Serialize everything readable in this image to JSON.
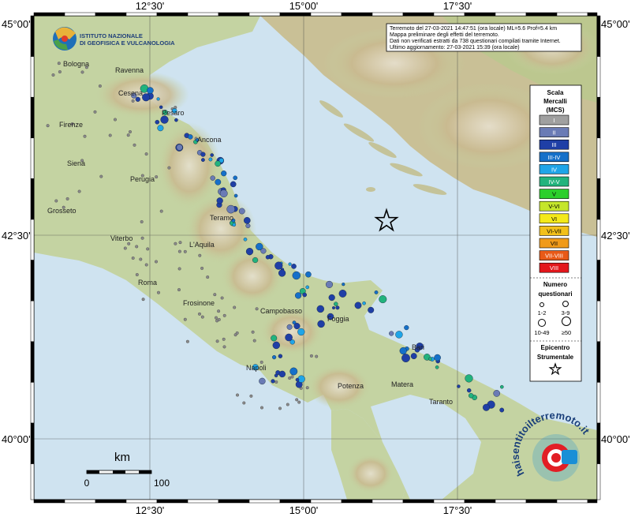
{
  "map": {
    "top_coords": [
      "12°30'",
      "15°00'",
      "17°30'"
    ],
    "bottom_coords": [
      "12°30'",
      "15°00'",
      "17°30'"
    ],
    "left_coords": [
      "45°00'",
      "42°30'",
      "40°00'"
    ],
    "right_coords": [
      "45°00'",
      "42°30'",
      "40°00'"
    ]
  },
  "logo": {
    "line1": "ISTITUTO NAZIONALE",
    "line2": "DI GEOFISICA E VULCANOLOGIA"
  },
  "info": {
    "line1": "Terremoto del 27-03-2021 14:47:51 (ora locale) ML=5.6 Prof=5.4 km",
    "line2": "Mappa preliminare degli effetti del terremoto.",
    "line3": "Dati non verificati estratti da 738 questionari compilati tramite Internet.",
    "line4": "Ultimo aggiornamento: 27-03-2021 15:39 (ora locale)"
  },
  "cities": [
    {
      "name": "Bologna"
    },
    {
      "name": "Ravenna"
    },
    {
      "name": "Cesena"
    },
    {
      "name": "Pesaro"
    },
    {
      "name": "Firenze"
    },
    {
      "name": "Ancona"
    },
    {
      "name": "Siena"
    },
    {
      "name": "Perugia"
    },
    {
      "name": "Grosseto"
    },
    {
      "name": "Teramo"
    },
    {
      "name": "Viterbo"
    },
    {
      "name": "L'Aquila"
    },
    {
      "name": "Roma"
    },
    {
      "name": "Frosinone"
    },
    {
      "name": "Campobasso"
    },
    {
      "name": "Foggia"
    },
    {
      "name": "Bari"
    },
    {
      "name": "Napoli"
    },
    {
      "name": "Matera"
    },
    {
      "name": "Potenza"
    },
    {
      "name": "Taranto"
    }
  ],
  "legend": {
    "title1": "Scala",
    "title2": "Mercalli",
    "title3": "(MCS)",
    "scale": [
      {
        "label": "I",
        "color": "#a0a0a0"
      },
      {
        "label": "II",
        "color": "#6a7bb5"
      },
      {
        "label": "III",
        "color": "#1f3fa6"
      },
      {
        "label": "III-IV",
        "color": "#1570c9"
      },
      {
        "label": "IV",
        "color": "#1fa5e8"
      },
      {
        "label": "IV-V",
        "color": "#22b37d"
      },
      {
        "label": "V",
        "color": "#2ccf2c"
      },
      {
        "label": "V-VI",
        "color": "#c5e62b"
      },
      {
        "label": "VI",
        "color": "#f4e91a"
      },
      {
        "label": "VI-VII",
        "color": "#f2c01a"
      },
      {
        "label": "VII",
        "color": "#f09a19"
      },
      {
        "label": "VII-VIII",
        "color": "#e85a17"
      },
      {
        "label": "VIII",
        "color": "#e3171c"
      }
    ],
    "count_title1": "Numero",
    "count_title2": "questionari",
    "counts": [
      "1-2",
      "3-9",
      "10-49",
      "≥50"
    ],
    "epicenter_title1": "Epicentro",
    "epicenter_title2": "Strumentale"
  },
  "scalebar": {
    "unit": "km",
    "start": "0",
    "end": "100"
  },
  "watermark": {
    "text": "haisentitoilterremoto.it"
  },
  "colors": {
    "sea": "#cfe3f0",
    "land": "#c4d3a2",
    "frame": "#000000"
  }
}
